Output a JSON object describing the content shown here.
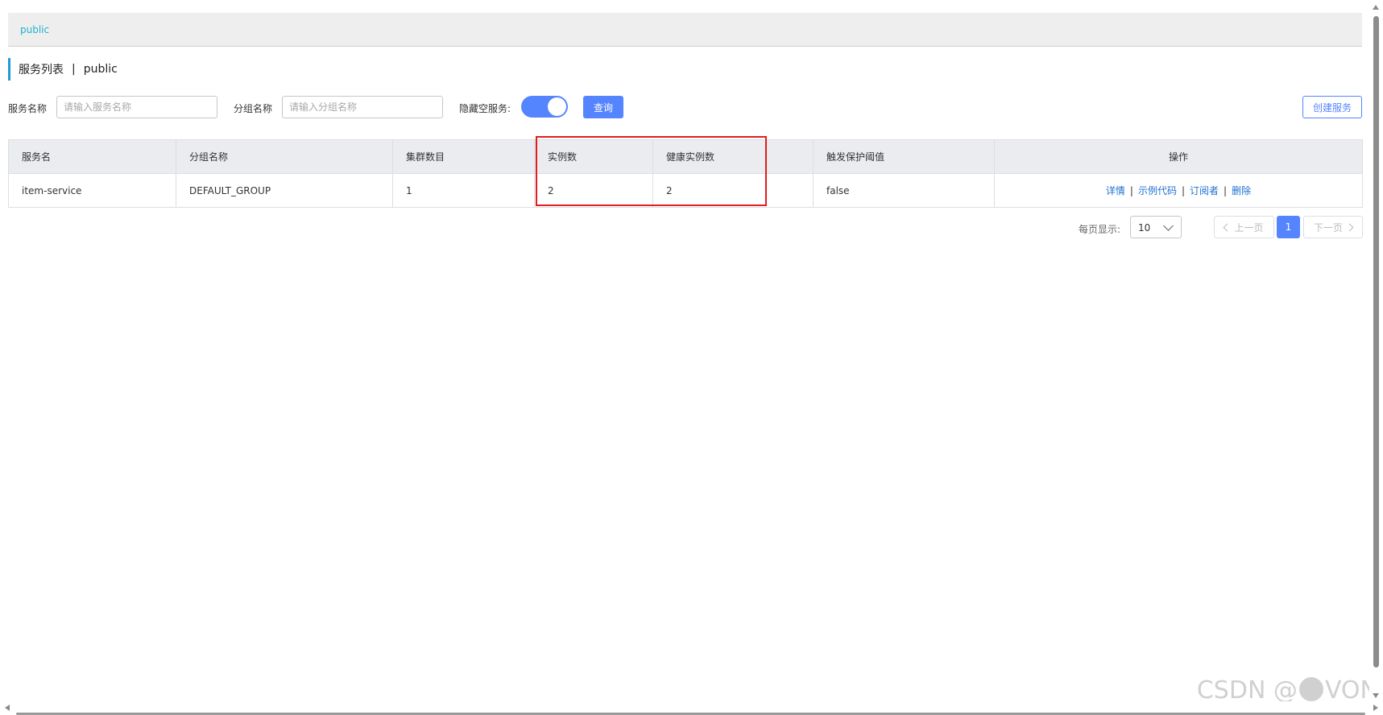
{
  "namespace_bar": {
    "current": "public"
  },
  "header": {
    "title": "服务列表",
    "separator": "|",
    "namespace": "public"
  },
  "filters": {
    "service_name_label": "服务名称",
    "service_name_placeholder": "请输入服务名称",
    "group_name_label": "分组名称",
    "group_name_placeholder": "请输入分组名称",
    "hide_empty_label": "隐藏空服务:",
    "hide_empty_enabled": true,
    "query_button": "查询",
    "create_button": "创建服务"
  },
  "table": {
    "columns": [
      "服务名",
      "分组名称",
      "集群数目",
      "实例数",
      "健康实例数",
      "触发保护阈值",
      "操作"
    ],
    "rows": [
      {
        "service": "item-service",
        "group": "DEFAULT_GROUP",
        "clusters": "1",
        "instances": "2",
        "healthy": "2",
        "threshold": "false",
        "actions": [
          "详情",
          "示例代码",
          "订阅者",
          "删除"
        ]
      }
    ],
    "highlighted_columns": [
      "实例数",
      "健康实例数"
    ],
    "highlight_color": "#e11d1d"
  },
  "pagination": {
    "page_size_label": "每页显示:",
    "page_size": "10",
    "prev": "上一页",
    "current": "1",
    "next": "下一页"
  },
  "colors": {
    "primary": "#5584ff",
    "link": "#1f6fd2",
    "namespace_link": "#20b1d0"
  },
  "watermark": {
    "left": "CSDN @",
    "right": "VON"
  }
}
